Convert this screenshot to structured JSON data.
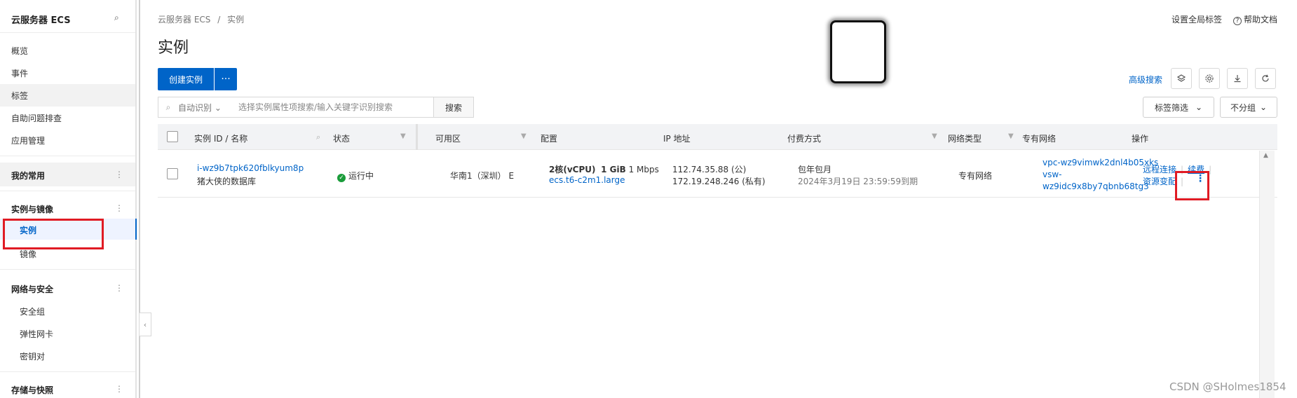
{
  "sidebar": {
    "title": "云服务器 ECS",
    "items": [
      "概览",
      "事件",
      "标签",
      "自助问题排查",
      "应用管理"
    ],
    "groups": [
      {
        "label": "我的常用",
        "items": []
      },
      {
        "label": "实例与镜像",
        "items": [
          "实例",
          "镜像"
        ]
      },
      {
        "label": "网络与安全",
        "items": [
          "安全组",
          "弹性网卡",
          "密钥对"
        ]
      },
      {
        "label": "存储与快照",
        "items": []
      }
    ],
    "kebab": "⋮",
    "search_icon": "⌕"
  },
  "header": {
    "breadcrumb": [
      "云服务器 ECS",
      "实例"
    ],
    "breadcrumb_sep": "/",
    "title": "实例",
    "global_tags": "设置全局标签",
    "help_docs": "帮助文档"
  },
  "toolbar": {
    "create_label": "创建实例",
    "more_label": "···",
    "advanced_search": "高级搜索",
    "search_mode": "自动识别",
    "search_placeholder": "选择实例属性项搜索/输入关键字识别搜索",
    "search_button": "搜索",
    "tag_filter": "标签筛选",
    "group_label": "不分组"
  },
  "table": {
    "columns": [
      "实例 ID / 名称",
      "状态",
      "可用区",
      "配置",
      "IP 地址",
      "付费方式",
      "网络类型",
      "专有网络",
      "操作"
    ],
    "rows": [
      {
        "instance_id": "i-wz9b7tpk620fblkyum8p",
        "instance_name": "猪大侠的数据库",
        "status": "运行中",
        "zone": "华南1（深圳） E",
        "cpu": "2核(vCPU)",
        "memory": "1 GiB",
        "bandwidth": "1 Mbps",
        "instance_type": "ecs.t6-c2m1.large",
        "ip_public": "112.74.35.88 (公)",
        "ip_private": "172.19.248.246 (私有)",
        "billing": "包年包月",
        "expiry": "2024年3月19日 23:59:59到期",
        "network_type": "专有网络",
        "vpc": "vpc-wz9vimwk2dnl4b05xks",
        "vsw_1": "vsw-",
        "vsw_2": "wz9idc9x8by7qbnb68tg3",
        "actions": [
          "远程连接",
          "续费",
          "资源变配"
        ],
        "more_icon": "⋮"
      }
    ]
  },
  "watermark": "CSDN @SHolmes1854",
  "colors": {
    "accent": "#0064c8",
    "highlight_box": "#e01b24",
    "status_running": "#1a9c3a"
  }
}
